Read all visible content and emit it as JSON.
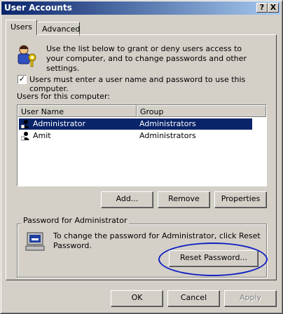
{
  "window": {
    "title": "User Accounts"
  },
  "titlebar": {
    "help_label": "?",
    "close_label": "X"
  },
  "tabs": [
    {
      "label": "Users",
      "active": true
    },
    {
      "label": "Advanced",
      "active": false
    }
  ],
  "intro": {
    "text": "Use the list below to grant or deny users access to your computer, and to change passwords and other settings.",
    "icon": "users-keys-icon"
  },
  "require_login": {
    "checked": true,
    "label": "Users must enter a user name and password to use this computer."
  },
  "users_list": {
    "label": "Users for this computer:",
    "columns": [
      "User Name",
      "Group"
    ],
    "rows": [
      {
        "name": "Administrator",
        "group": "Administrators",
        "selected": true
      },
      {
        "name": "Amit",
        "group": "Administrators",
        "selected": false
      }
    ]
  },
  "list_buttons": {
    "add": "Add...",
    "remove": "Remove",
    "properties": "Properties"
  },
  "password_group": {
    "title": "Password for Administrator",
    "text": "To change the password for Administrator, click Reset Password.",
    "reset_button": "Reset Password...",
    "icon": "computer-password-icon"
  },
  "dialog_buttons": {
    "ok": "OK",
    "cancel": "Cancel",
    "apply": "Apply",
    "apply_enabled": false
  },
  "colors": {
    "titlebar_start": "#0a246a",
    "titlebar_end": "#a6caf0",
    "selection": "#0a246a",
    "annotation_ellipse": "#1020c0"
  }
}
